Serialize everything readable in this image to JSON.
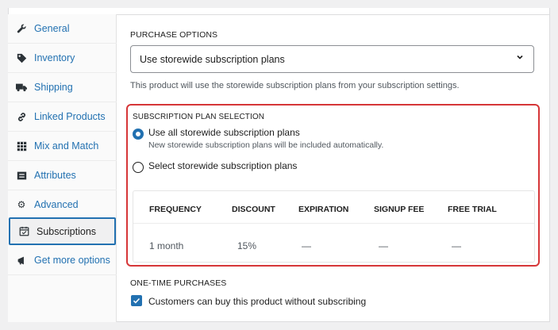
{
  "sidebar": {
    "items": [
      {
        "label": "General",
        "icon": "wrench-icon"
      },
      {
        "label": "Inventory",
        "icon": "tag-icon"
      },
      {
        "label": "Shipping",
        "icon": "truck-icon"
      },
      {
        "label": "Linked Products",
        "icon": "link-icon"
      },
      {
        "label": "Mix and Match",
        "icon": "grid-icon"
      },
      {
        "label": "Attributes",
        "icon": "list-icon"
      },
      {
        "label": "Advanced",
        "icon": "gear-icon"
      },
      {
        "label": "Subscriptions",
        "icon": "calendar-icon"
      },
      {
        "label": "Get more options",
        "icon": "megaphone-icon"
      }
    ],
    "active": "Subscriptions"
  },
  "purchase": {
    "section_label": "PURCHASE OPTIONS",
    "selected_value": "Use storewide subscription plans",
    "hint": "This product will use the storewide subscription plans from your subscription settings."
  },
  "plan_selection": {
    "section_label": "SUBSCRIPTION PLAN SELECTION",
    "options": [
      {
        "label": "Use all storewide subscription plans",
        "description": "New storewide subscription plans will be included automatically.",
        "checked": true
      },
      {
        "label": "Select storewide subscription plans",
        "checked": false
      }
    ],
    "table": {
      "headers": [
        "FREQUENCY",
        "DISCOUNT",
        "EXPIRATION",
        "SIGNUP FEE",
        "FREE TRIAL"
      ],
      "rows": [
        [
          "1 month",
          "15%",
          "—",
          "—",
          "—"
        ]
      ]
    }
  },
  "one_time": {
    "section_label": "ONE-TIME PURCHASES",
    "checkbox_label": "Customers can buy this product without subscribing",
    "checked": true
  },
  "colors": {
    "accent": "#2271b1",
    "highlight": "#d63638"
  }
}
